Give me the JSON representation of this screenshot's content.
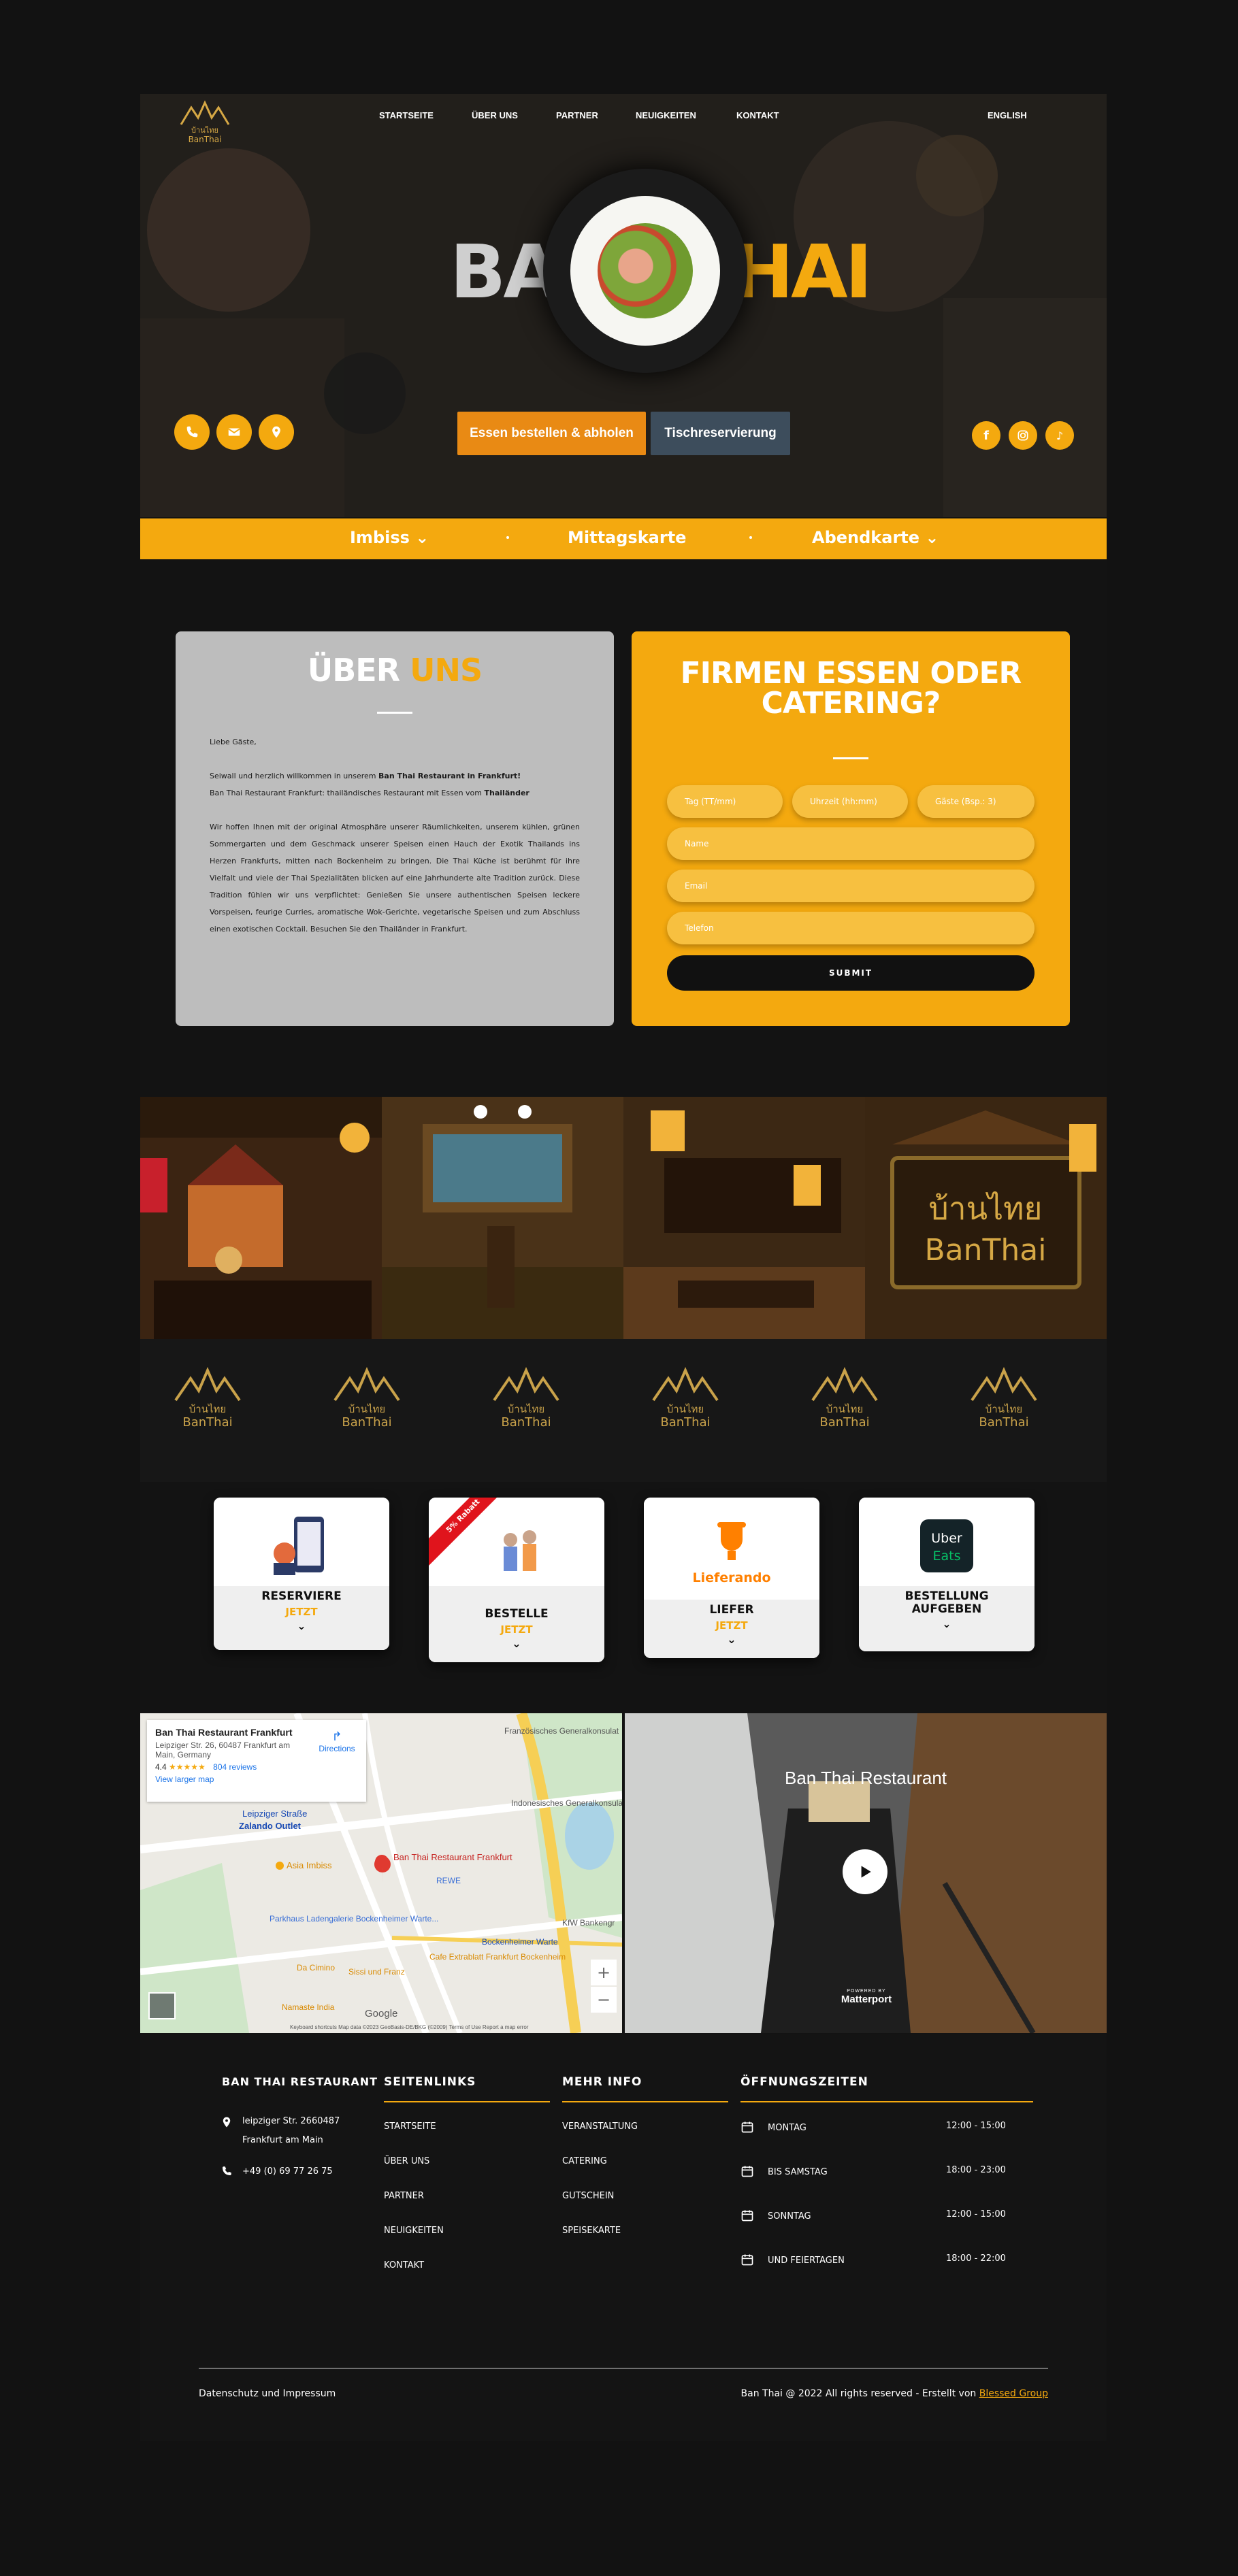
{
  "nav": {
    "items": [
      "STARTSEITE",
      "ÜBER UNS",
      "PARTNER",
      "NEUIGKEITEN",
      "KONTAKT"
    ],
    "language": "ENGLISH"
  },
  "hero": {
    "brand_left": "BAN",
    "brand_right": "THAI",
    "order_button": "Essen bestellen & abholen",
    "reserve_button": "Tischreservierung"
  },
  "menubar": {
    "imbiss": "Imbiss ⌄",
    "mittag": "Mittagskarte",
    "abend": "Abendkarte ⌄"
  },
  "about": {
    "title_white": "ÜBER",
    "title_orange": "UNS",
    "greeting": "Liebe Gäste,",
    "p1_a": "Seiwall und herzlich willkommen in unserem ",
    "p1_b": "Ban Thai Restaurant in Frankfurt!",
    "p2_a": "Ban Thai Restaurant Frankfurt: thailändisches Restaurant mit Essen vom ",
    "p2_b": "Thailänder",
    "p3": "Wir hoffen Ihnen mit der original Atmosphäre unserer Räumlichkeiten, unserem kühlen, grünen Sommergarten und dem Geschmack unserer Speisen einen Hauch der Exotik Thailands ins Herzen Frankfurts, mitten nach Bockenheim zu bringen. Die Thai Küche ist berühmt für ihre Vielfalt und viele der Thai Spezialitäten blicken auf eine Jahrhunderte alte Tradition zurück. Diese Tradition fühlen wir uns verpflichtet: Genießen Sie unsere authentischen Speisen leckere Vorspeisen, feurige Curries, aromatische Wok-Gerichte, vegetarische Speisen und zum Abschluss einen exotischen Cocktail. Besuchen Sie den Thailänder in Frankfurt."
  },
  "catering": {
    "title_line1": "FIRMEN ESSEN ODER",
    "title_line2": "CATERING?",
    "fields": {
      "date": "Tag (TT/mm)",
      "time": "Uhrzeit (hh:mm)",
      "guests": "Gäste (Bsp.: 3)",
      "name": "Name",
      "email": "Email",
      "phone": "Telefon"
    },
    "submit": "SUBMIT"
  },
  "logo_text": {
    "thai": "บ้านไทย",
    "latin": "BanThai"
  },
  "services": [
    {
      "line1": "RESERVIERE",
      "line2": "JETZT"
    },
    {
      "line1": "BESTELLE",
      "line2": "JETZT",
      "ribbon": "5% Rabatt"
    },
    {
      "line1": "LIEFER",
      "line2": "JETZT",
      "brand": "Lieferando"
    },
    {
      "line1": "BESTELLUNG",
      "line1b": "AUFGEBEN",
      "brand_a": "Uber",
      "brand_b": "Eats"
    }
  ],
  "map": {
    "place": "Ban Thai Restaurant Frankfurt",
    "address": "Leipziger Str. 26, 60487 Frankfurt am Main, Germany",
    "rating": "4.4",
    "stars": "★★★★★",
    "reviews": "804 reviews",
    "larger": "View larger map",
    "directions": "Directions",
    "labels": {
      "leipziger": "Leipziger Straße",
      "zalando": "Zalando Outlet",
      "asia": "Asia Imbiss",
      "pin": "Ban Thai Restaurant Frankfurt",
      "rewe": "REWE",
      "parkhaus": "Parkhaus Ladengalerie Bockenheimer Warte...",
      "bockenheimer": "Bockenheimer Warte",
      "kfw": "KfW Bankengr",
      "cafe": "Cafe Extrablatt Frankfurt Bockenheim",
      "dacimino": "Da Cimino",
      "sissi": "Sissi und Franz",
      "namaste": "Namaste India",
      "fr": "Französisches Generalkonsulat",
      "indo": "Indonesisches Generalkonsulat",
      "google": "Google",
      "attr": "Keyboard shortcuts   Map data ©2023 GeoBasis-DE/BKG (©2009)   Terms of Use   Report a map error"
    }
  },
  "tour": {
    "title": "Ban Thai Restaurant",
    "powered": "POWERED BY",
    "brand": "Matterport"
  },
  "footer": {
    "col1_title": "BAN THAI RESTAURANT",
    "addr1": "leipziger Str. 2660487",
    "addr2": "Frankfurt am Main",
    "phone": "+49 (0) 69 77 26 75",
    "col2_title": "SEITENLINKS",
    "links": [
      "STARTSEITE",
      "ÜBER UNS",
      "PARTNER",
      "NEUIGKEITEN",
      "KONTAKT"
    ],
    "col3_title": "MEHR INFO",
    "info": [
      "VERANSTALTUNG",
      "CATERING",
      "GUTSCHEIN",
      "SPEISEKARTE"
    ],
    "col4_title": "ÖFFNUNGSZEITEN",
    "hours": [
      {
        "day": "MONTAG",
        "time": "12:00 - 15:00"
      },
      {
        "day": "BIS SAMSTAG",
        "time": "18:00 - 23:00"
      },
      {
        "day": "SONNTAG",
        "time": "12:00 - 15:00"
      },
      {
        "day": "UND FEIERTAGEN",
        "time": "18:00 - 22:00"
      }
    ],
    "legal": "Datenschutz und Impressum",
    "copy": "Ban Thai @ 2022 All rights reserved - Erstellt von ",
    "creator": "Blessed Group"
  },
  "colors": {
    "accent": "#f4a90f",
    "dark": "#131313",
    "reserve": "#3d4d5c"
  }
}
